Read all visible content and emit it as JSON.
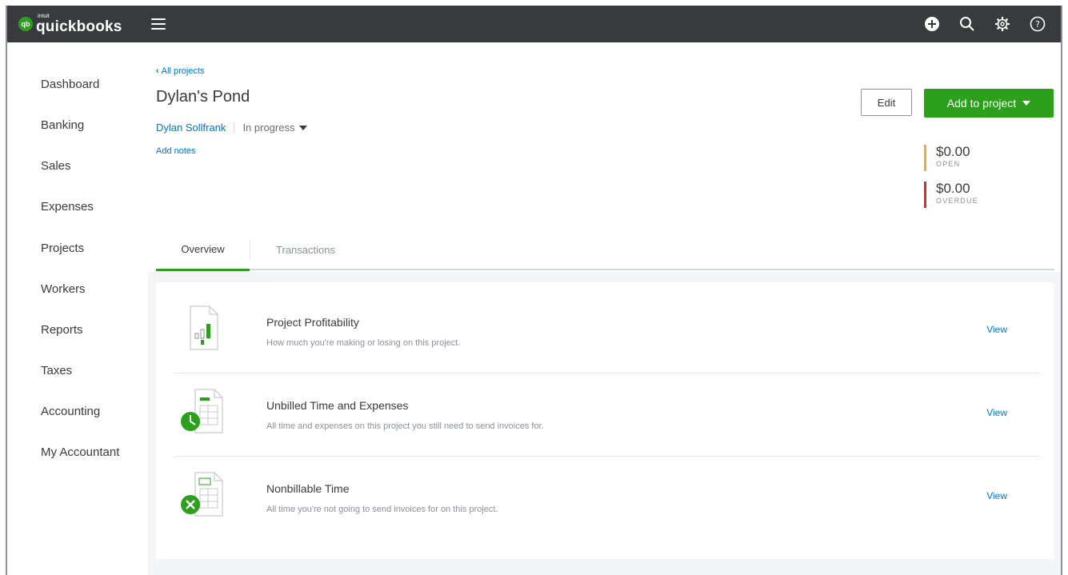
{
  "brand": {
    "badge": "qb",
    "intuit": "intuit",
    "name": "quickbooks"
  },
  "topbar": {
    "icons": [
      "plus-circle-icon",
      "search-icon",
      "gear-icon",
      "help-icon"
    ]
  },
  "sidebar": {
    "items": [
      {
        "label": "Dashboard"
      },
      {
        "label": "Banking"
      },
      {
        "label": "Sales"
      },
      {
        "label": "Expenses"
      },
      {
        "label": "Projects"
      },
      {
        "label": "Workers"
      },
      {
        "label": "Reports"
      },
      {
        "label": "Taxes"
      },
      {
        "label": "Accounting"
      },
      {
        "label": "My Accountant"
      }
    ]
  },
  "header": {
    "back_label": "All projects",
    "title": "Dylan's Pond",
    "customer": "Dylan Sollfrank",
    "status": "In progress",
    "add_notes": "Add notes",
    "edit_label": "Edit",
    "add_label": "Add to project"
  },
  "balances": {
    "open": {
      "amount": "$0.00",
      "label": "OPEN",
      "color": "#f2a93b"
    },
    "overdue": {
      "amount": "$0.00",
      "label": "OVERDUE",
      "color": "#c9302c"
    }
  },
  "tabs": [
    {
      "label": "Overview",
      "active": true
    },
    {
      "label": "Transactions",
      "active": false
    }
  ],
  "overview_rows": [
    {
      "title": "Project Profitability",
      "description": "How much you're making or losing on this project.",
      "action": "View",
      "icon": "profitability-report-icon"
    },
    {
      "title": "Unbilled Time and Expenses",
      "description": "All time and expenses on this project you still need to send invoices for.",
      "action": "View",
      "icon": "unbilled-time-icon"
    },
    {
      "title": "Nonbillable Time",
      "description": "All time you're not going to send invoices for on this project.",
      "action": "View",
      "icon": "nonbillable-time-icon"
    }
  ],
  "colors": {
    "brand_green": "#2ca01c",
    "link_blue": "#0077c5",
    "topbar": "#393a3d"
  }
}
